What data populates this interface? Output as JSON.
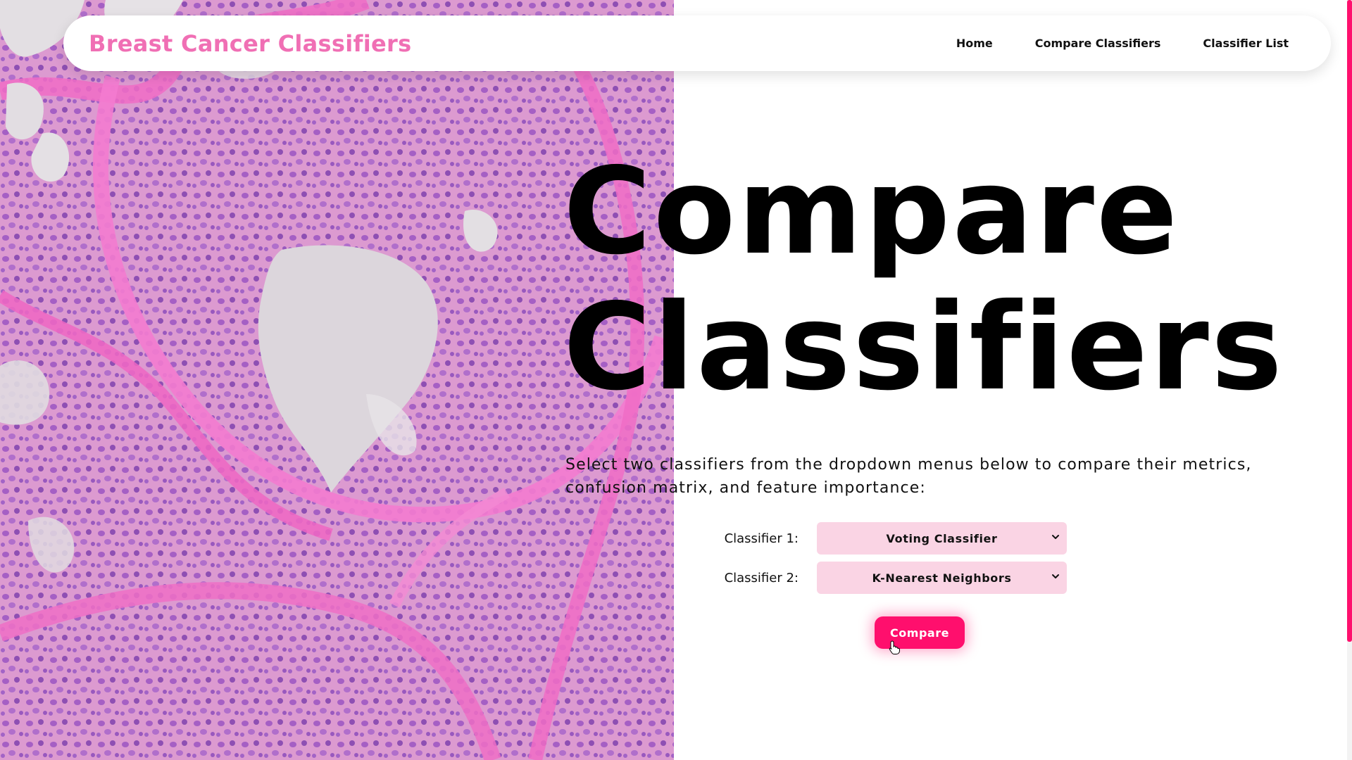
{
  "navbar": {
    "brand": "Breast Cancer Classifiers",
    "links": [
      {
        "label": "Home"
      },
      {
        "label": "Compare Classifiers"
      },
      {
        "label": "Classifier List"
      }
    ]
  },
  "hero": {
    "title_line1": "Compare",
    "title_line2": "Classifiers",
    "description": "Select two classifiers from the dropdown menus below to compare their metrics, confusion matrix, and feature importance:"
  },
  "form": {
    "classifier1": {
      "label": "Classifier 1:",
      "selected": "Voting Classifier"
    },
    "classifier2": {
      "label": "Classifier 2:",
      "selected": "K-Nearest Neighbors"
    },
    "compare_label": "Compare"
  },
  "colors": {
    "brand": "#f06fb4",
    "accent": "#ff0f6d",
    "select_bg": "#fad4e4",
    "tissue_pink": "#e7a8d6",
    "nuclei_purple": "#9b5cc0"
  },
  "icons": {
    "select_chevron": "chevron-down-icon",
    "cursor": "hand-pointer-icon"
  }
}
